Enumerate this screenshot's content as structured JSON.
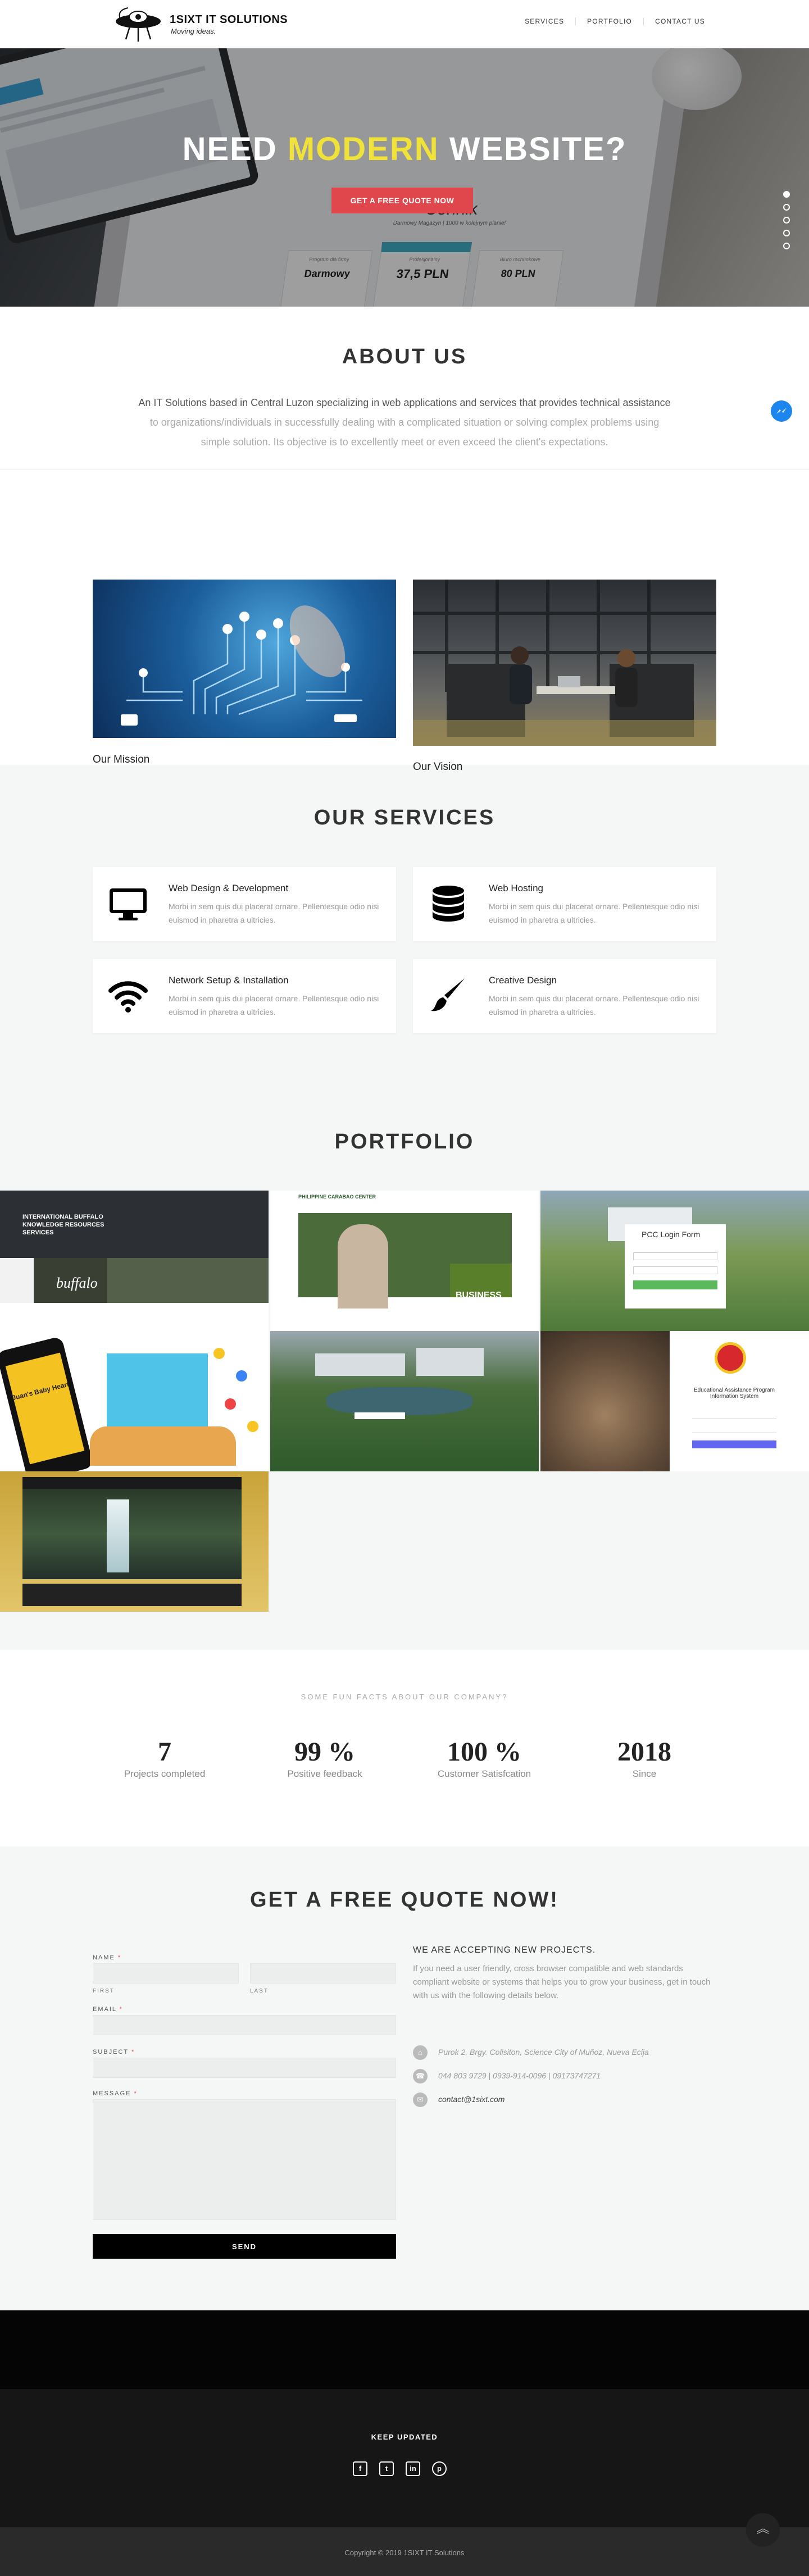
{
  "brand": {
    "title": "1SIXT IT SOLUTIONS",
    "tagline": "Moving ideas."
  },
  "nav": {
    "items": [
      "SERVICES",
      "PORTFOLIO",
      "CONTACT US"
    ]
  },
  "hero": {
    "title_pre": "NEED ",
    "title_highlight": "MODERN",
    "title_post": " WEBSITE?",
    "button": "GET A FREE QUOTE NOW",
    "slide_count": 5,
    "active_slide": 1,
    "screen_texts": {
      "cennik": "Cennik",
      "cennik_sub": "Darmowy Magazyn | 1000 w kolejnym planie!",
      "plan1_title": "Program dla firmy",
      "plan1_price": "Darmowy",
      "plan2_title": "Profesjonalny",
      "plan2_price": "37,5 PLN",
      "plan3_title": "Biuro rachunkowe",
      "plan3_price": "80 PLN"
    }
  },
  "about": {
    "title": "ABOUT US",
    "text_line1": "An IT Solutions based in Central Luzon specializing in web applications and services that provides technical  assistance",
    "text_line2": "to organizations/individuals in successfully dealing with a complicated situation or solving complex problems using",
    "text_line3": "simple solution. Its objective is to excellently meet or even exceed the client's expectations."
  },
  "mission": {
    "mission_caption": "Our Mission",
    "vision_caption": "Our Vision"
  },
  "services": {
    "title": "OUR SERVICES",
    "items": [
      {
        "title": "Web Design & Development",
        "desc": "Morbi in sem quis dui placerat ornare. Pellentesque odio nisi euismod in pharetra a ultricies.",
        "icon": "monitor-icon"
      },
      {
        "title": "Web Hosting",
        "desc": "Morbi in sem quis dui placerat ornare. Pellentesque odio nisi euismod in pharetra a ultricies.",
        "icon": "database-icon"
      },
      {
        "title": "Network Setup & Installation",
        "desc": "Morbi in sem quis dui placerat ornare. Pellentesque odio nisi euismod in pharetra a ultricies.",
        "icon": "wifi-icon"
      },
      {
        "title": "Creative Design",
        "desc": "Morbi in sem quis dui placerat ornare. Pellentesque odio nisi euismod in pharetra a ultricies.",
        "icon": "paintbrush-icon"
      }
    ]
  },
  "portfolio": {
    "title": "PORTFOLIO",
    "texts": {
      "buffalo_header": "INTERNATIONAL BUFFALO KNOWLEDGE RESOURCES SERVICES",
      "buffalo_word": "buffalo",
      "carabao_header": "PHILIPPINE CARABAO CENTER",
      "business": "BUSINESS",
      "pcc_login": "PCC Login Form",
      "bakery_title": "Juan's Baby Heart",
      "eaps_title": "Educational Assistance Program Information System"
    }
  },
  "facts": {
    "label": "SOME FUN FACTS ABOUT OUR COMPANY?",
    "items": [
      {
        "num": "7",
        "label": "Projects completed"
      },
      {
        "num": "99 %",
        "label": "Positive feedback"
      },
      {
        "num": "100 %",
        "label": "Customer Satisfcation"
      },
      {
        "num": "2018",
        "label": "Since"
      }
    ]
  },
  "quote": {
    "title": "GET A FREE QUOTE NOW!",
    "name_label": "NAME",
    "first_label": "FIRST",
    "last_label": "LAST",
    "email_label": "EMAIL",
    "subject_label": "SUBJECT",
    "message_label": "MESSAGE",
    "required_mark": "*",
    "send": "SEND",
    "accepting": "WE ARE ACCEPTING NEW PROJECTS.",
    "pitch": "If you need a user friendly, cross browser compatible and web standards compliant website or systems that helps you to grow your business, get in touch with us with the following details below.",
    "address": "Purok 2, Brgy. Colisiton, Science City of Muñoz, Nueva Ecija",
    "phone": "044 803 9729 | 0939-914-0096 | 09173747271",
    "email": "contact@1sixt.com"
  },
  "footer": {
    "keep_updated": "KEEP UPDATED",
    "socials": [
      "facebook-icon",
      "twitter-icon",
      "linkedin-icon",
      "pinterest-icon"
    ],
    "copyright": "Copyright © 2019 1SIXT IT Solutions"
  },
  "colors": {
    "accent": "#e0474c",
    "highlight": "#f1e23a",
    "messenger": "#1c86ee"
  }
}
